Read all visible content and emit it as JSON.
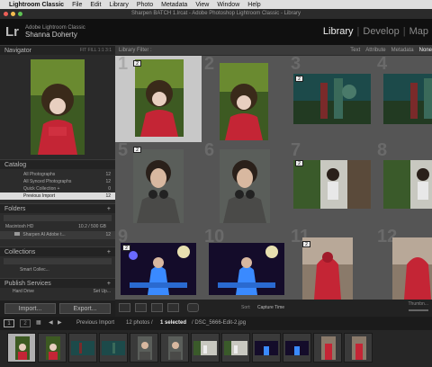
{
  "menubar": {
    "app": "Lightroom Classic",
    "items": [
      "File",
      "Edit",
      "Library",
      "Photo",
      "Metadata",
      "View",
      "Window",
      "Help"
    ]
  },
  "window_title": "Sharpen BATCH 1.lrcat - Adobe Photoshop Lightroom Classic - Library",
  "identity": {
    "logo": "Lr",
    "product": "Adobe Lightroom Classic",
    "user": "Shanna Doherty"
  },
  "modules": [
    "Library",
    "Develop",
    "Map"
  ],
  "active_module": "Library",
  "navigator": {
    "title": "Navigator",
    "options": "FIT  FILL  1:1  3:1"
  },
  "catalog": {
    "title": "Catalog",
    "rows": [
      {
        "label": "All Photographs",
        "count": "12"
      },
      {
        "label": "All Synced Photographs",
        "count": "12"
      },
      {
        "label": "Quick Collection +",
        "count": "0"
      },
      {
        "label": "Previous Import",
        "count": "12"
      }
    ]
  },
  "folders": {
    "title": "Folders",
    "volume": "Macintosh HD",
    "volume_info": "10.2 / 500 GB",
    "folder": "Sharpen AI Adobe t...",
    "folder_count": "12"
  },
  "collections": {
    "title": "Collections",
    "item": "Smart Collec...",
    "plus": "+"
  },
  "publish": {
    "title": "Publish Services",
    "plus": "+",
    "item": "Hard Drive",
    "item_action": "Set Up..."
  },
  "buttons": {
    "import": "Import...",
    "export": "Export..."
  },
  "library_filter": {
    "label": "Library Filter :",
    "options": [
      "Text",
      "Attribute",
      "Metadata",
      "None"
    ],
    "active": "None"
  },
  "grid": {
    "cells": [
      {
        "num": "1",
        "badge": "2",
        "selected": true
      },
      {
        "num": "2",
        "badge": "",
        "selected": false
      },
      {
        "num": "3",
        "badge": "2",
        "selected": false
      },
      {
        "num": "4",
        "badge": "",
        "selected": false
      },
      {
        "num": "5",
        "badge": "2",
        "selected": false
      },
      {
        "num": "6",
        "badge": "",
        "selected": false
      },
      {
        "num": "7",
        "badge": "2",
        "selected": false
      },
      {
        "num": "8",
        "badge": "",
        "selected": false
      },
      {
        "num": "9",
        "badge": "2",
        "selected": false
      },
      {
        "num": "10",
        "badge": "",
        "selected": false
      },
      {
        "num": "11",
        "badge": "2",
        "selected": false
      },
      {
        "num": "12",
        "badge": "",
        "selected": false
      }
    ]
  },
  "toolbar": {
    "sort_label": "Sort:",
    "sort_value": "Capture Time",
    "thumbnails_label": "Thumbn..."
  },
  "filmstrip_bar": {
    "page1": "1",
    "page2": "2",
    "source": "Previous Import",
    "summary": "12 photos /",
    "selected": "1 selected",
    "filename": "/ DSC_5666-Edit-2.jpg"
  },
  "colors": {
    "accent": "#dcdcdc",
    "menu_bg": "#dedede",
    "panel_bg": "#2c2c2c",
    "grid_bg": "#4a4a4a"
  }
}
